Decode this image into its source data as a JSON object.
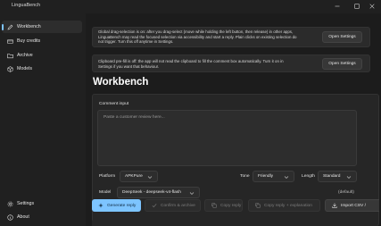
{
  "window": {
    "title": "LinguaBench",
    "controls": [
      "minimize-icon",
      "maximize-icon",
      "close-icon"
    ]
  },
  "sidebar": {
    "items": [
      {
        "label": "Workbench",
        "icon": "pencil-icon",
        "active": true
      },
      {
        "label": "Buy credits",
        "icon": "credit-card-icon",
        "active": false
      },
      {
        "label": "Archive",
        "icon": "folder-icon",
        "active": false
      },
      {
        "label": "Models",
        "icon": "cube-icon",
        "active": false
      }
    ],
    "footer_items": [
      {
        "label": "Settings",
        "icon": "gear-icon"
      },
      {
        "label": "About",
        "icon": "info-icon"
      }
    ]
  },
  "banners": [
    {
      "text_line1": "Global drag-selection is on: after you drag-select (move while holding the left button, then release) in other apps,",
      "text_line2": "LinguaBench may read the focused selection via accessibility and start a reply. Plain clicks on existing selection do",
      "text_line3": "not trigger. Turn this off anytime in Settings.",
      "button": "Open Settings"
    },
    {
      "text_line1": "Clipboard pre-fill is off: the app will not read the clipboard to fill the comment box automatically. Turn it on in",
      "text_line2": "Settings if you want that behaviour.",
      "button": "Open Settings"
    }
  ],
  "main": {
    "title": "Workbench",
    "comment_label": "Comment input",
    "comment_placeholder": "Paste a customer review here...",
    "platform_label": "Platform",
    "platform_value": "APKPure",
    "tone_label": "Tone",
    "tone_value": "Friendly",
    "length_label": "Length",
    "length_value": "Standard",
    "model_label": "Model",
    "model_value": "DeepSeek - deepseek-v4-flash",
    "model_hint": "(default)"
  },
  "actions": [
    {
      "label": "Generate reply",
      "icon": "sparkle-icon",
      "state": "primary"
    },
    {
      "label": "Confirm & archive",
      "icon": "check-icon",
      "state": "disabled"
    },
    {
      "label": "Copy reply",
      "icon": "copy-icon",
      "state": "disabled"
    },
    {
      "label": "Copy reply + explanation",
      "icon": "copy-icon",
      "state": "disabled"
    },
    {
      "label": "Import CSV /",
      "icon": "import-icon",
      "state": "normal"
    }
  ],
  "colors": {
    "accent": "#7dc4ff",
    "background": "#1c1c1c",
    "sidebar": "#202020",
    "card": "#2b2b2b"
  }
}
